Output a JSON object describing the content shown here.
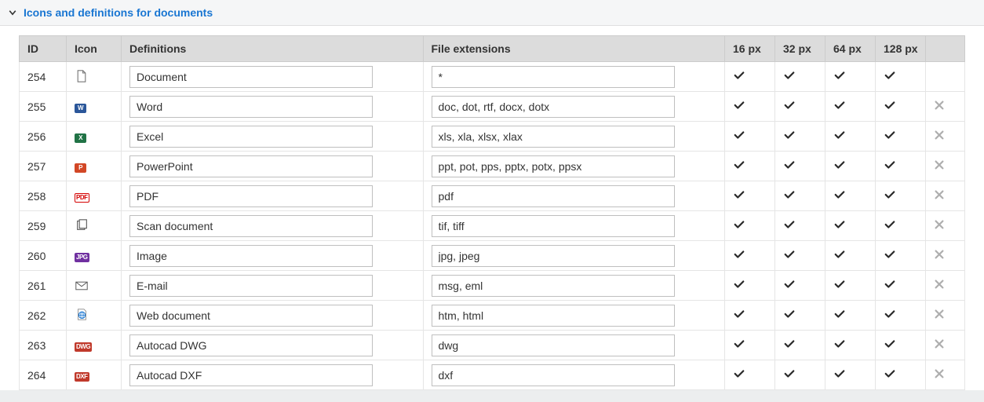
{
  "panel": {
    "title": "Icons and definitions for documents"
  },
  "columns": {
    "id": "ID",
    "icon": "Icon",
    "definitions": "Definitions",
    "extensions": "File extensions",
    "px16": "16 px",
    "px32": "32 px",
    "px64": "64 px",
    "px128": "128 px",
    "delete": ""
  },
  "rows": [
    {
      "id": "254",
      "icon": "document",
      "definition": "Document",
      "ext": "*",
      "px16": true,
      "px32": true,
      "px64": true,
      "px128": true,
      "deletable": false
    },
    {
      "id": "255",
      "icon": "word",
      "definition": "Word",
      "ext": "doc, dot, rtf, docx, dotx",
      "px16": true,
      "px32": true,
      "px64": true,
      "px128": true,
      "deletable": true
    },
    {
      "id": "256",
      "icon": "excel",
      "definition": "Excel",
      "ext": "xls, xla, xlsx, xlax",
      "px16": true,
      "px32": true,
      "px64": true,
      "px128": true,
      "deletable": true
    },
    {
      "id": "257",
      "icon": "powerpoint",
      "definition": "PowerPoint",
      "ext": "ppt, pot, pps, pptx, potx, ppsx",
      "px16": true,
      "px32": true,
      "px64": true,
      "px128": true,
      "deletable": true
    },
    {
      "id": "258",
      "icon": "pdf",
      "definition": "PDF",
      "ext": "pdf",
      "px16": true,
      "px32": true,
      "px64": true,
      "px128": true,
      "deletable": true
    },
    {
      "id": "259",
      "icon": "scan",
      "definition": "Scan document",
      "ext": "tif, tiff",
      "px16": true,
      "px32": true,
      "px64": true,
      "px128": true,
      "deletable": true
    },
    {
      "id": "260",
      "icon": "image",
      "definition": "Image",
      "ext": "jpg, jpeg",
      "px16": true,
      "px32": true,
      "px64": true,
      "px128": true,
      "deletable": true
    },
    {
      "id": "261",
      "icon": "email",
      "definition": "E-mail",
      "ext": "msg, eml",
      "px16": true,
      "px32": true,
      "px64": true,
      "px128": true,
      "deletable": true
    },
    {
      "id": "262",
      "icon": "web",
      "definition": "Web document",
      "ext": "htm, html",
      "px16": true,
      "px32": true,
      "px64": true,
      "px128": true,
      "deletable": true
    },
    {
      "id": "263",
      "icon": "dwg",
      "definition": "Autocad DWG",
      "ext": "dwg",
      "px16": true,
      "px32": true,
      "px64": true,
      "px128": true,
      "deletable": true
    },
    {
      "id": "264",
      "icon": "dxf",
      "definition": "Autocad DXF",
      "ext": "dxf",
      "px16": true,
      "px32": true,
      "px64": true,
      "px128": true,
      "deletable": true
    }
  ],
  "icons": {
    "word_label": "W",
    "excel_label": "X",
    "ppt_label": "P",
    "pdf_label": "PDF",
    "jpg_label": "JPG",
    "dwg_label": "DWG",
    "dxf_label": "DXF"
  },
  "colors": {
    "accent": "#1976d2",
    "word": "#2b579a",
    "excel": "#217346",
    "powerpoint": "#d24726",
    "pdf": "#d40000",
    "jpg": "#7030a0",
    "dwg": "#c0392b",
    "dxf": "#c0392b",
    "web": "#1976d2"
  }
}
